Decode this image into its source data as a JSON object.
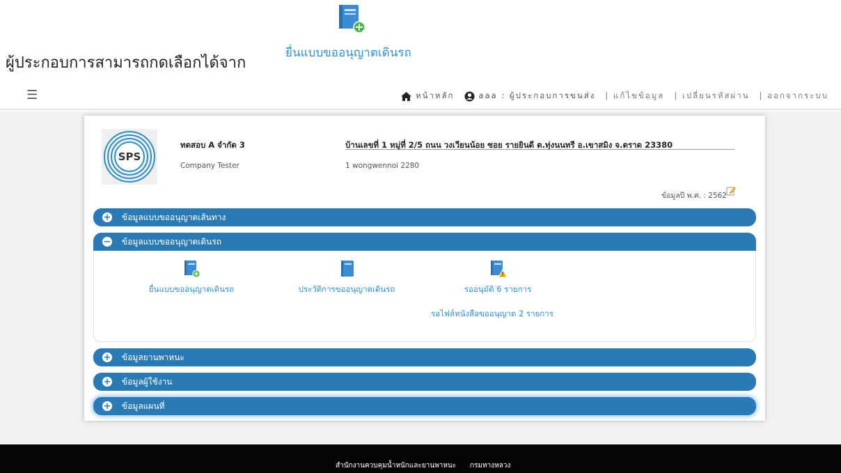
{
  "instruction": {
    "text": "ผู้ประกอบการสามารถกดเลือกได้จาก",
    "link": "ยื่นแบบขออนุญาตเดินรถ",
    "icon": "document-add-icon"
  },
  "topnav": {
    "menu_icon": "☰",
    "home": "หน้าหลัก",
    "user": "aaa : ผู้ประกอบการขนส่ง",
    "edit_profile": "| แก้ไขข้อมูล",
    "change_password": "| เปลี่ยนรหัสผ่าน",
    "logout": "| ออกจากระบบ"
  },
  "company": {
    "logo_text": "SPS",
    "name_th": "ทดสอบ A จำกัด 3",
    "name_en": "Company Tester",
    "address_th": "บ้านเลขที่ 1 หมู่ที่ 2/5 ถนน วงเวียนน้อย ซอย รายยินดี ต.ทุ่งนนทรี อ.เขาสมิง จ.ตราด 23380",
    "address_en": "1 wongwennoi 2280",
    "year_label": "ข้อมูลปี พ.ศ. : 2562"
  },
  "accordion": {
    "route_permit": {
      "sign": "+",
      "label": "ข้อมูลแบบขออนุญาตเส้นทาง"
    },
    "operation_permit": {
      "sign": "−",
      "label": "ข้อมูลแบบขออนุญาตเดินรถ"
    },
    "vehicles": {
      "sign": "+",
      "label": "ข้อมูลยานพาหนะ"
    },
    "users": {
      "sign": "+",
      "label": "ข้อมูลผู้ใช้งาน"
    },
    "map": {
      "sign": "+",
      "label": "ข้อมูลแผนที่"
    }
  },
  "panel": {
    "submit": {
      "label": "ยื่นแบบขออนุญาตเดินรถ",
      "icon": "document-add-icon"
    },
    "history": {
      "label": "ประวัติการขออนุญาตเดินรถ",
      "icon": "document-icon"
    },
    "pending": {
      "label": "รออนุมัติ 6 รายการ",
      "icon": "document-warning-icon"
    },
    "pending_files": "รอไฟล์หนังสือขออนุญาต 2 รายการ"
  },
  "footer": {
    "org": "สำนักงานควบคุมน้ำหนักและยานพาหนะ",
    "dept": "กรมทางหลวง"
  },
  "colors": {
    "accent": "#2a7ab5",
    "link": "#2d8fd6",
    "footer_bg": "#050505",
    "page_bg": "#f1f1f1"
  }
}
